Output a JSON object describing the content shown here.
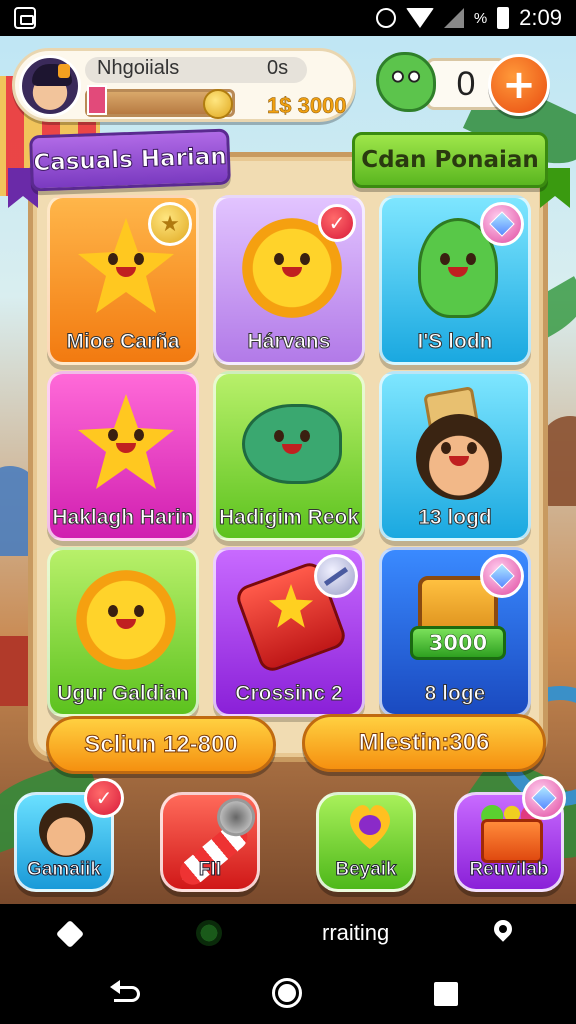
{
  "status_bar": {
    "time": "2:09",
    "battery_text": "%"
  },
  "header": {
    "player_name": "Nhgoiials",
    "player_level": "0s",
    "coins": "1$ 3000",
    "gems": "0",
    "add_button": "+",
    "xp_progress": 0.85
  },
  "ribbons": {
    "left": "Casuals Harian",
    "right": "Cdan Ponaian"
  },
  "tiles": [
    {
      "label": "Mioe Carña",
      "color": "orange",
      "badge": "coin-icon"
    },
    {
      "label": "Hárvans",
      "color": "lilac",
      "badge": "check-icon"
    },
    {
      "label": "I'S lodn",
      "color": "cyan",
      "badge": "gem-icon"
    },
    {
      "label": "Haklagh Harin",
      "color": "pink",
      "badge": ""
    },
    {
      "label": "Hadigim Reok",
      "color": "green",
      "badge": ""
    },
    {
      "label": "13 logd",
      "color": "cyan",
      "badge": ""
    },
    {
      "label": "Ugur Galdian",
      "color": "green",
      "badge": ""
    },
    {
      "label": "Crossinc 2",
      "color": "purple",
      "badge": "no-entry-icon"
    },
    {
      "label": "8 loge",
      "color": "blue",
      "badge": "gem-icon",
      "prize": "3000"
    }
  ],
  "pills": {
    "left": "Scliun 12-800",
    "right": "Mlestin:306"
  },
  "dock": [
    {
      "label": "Gamaiik"
    },
    {
      "label": "FII"
    },
    {
      "label": "Beyaik"
    },
    {
      "label": "Reuvilab"
    }
  ],
  "toolbar": {
    "text": "rraiting"
  }
}
